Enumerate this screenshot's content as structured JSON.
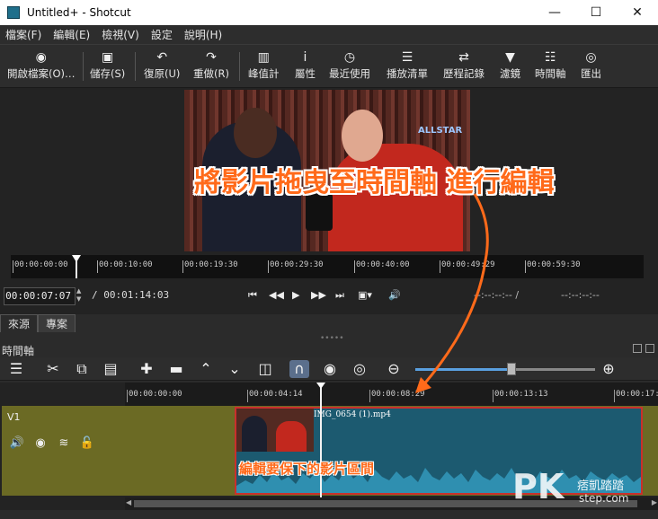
{
  "window": {
    "title": "Untitled+ - Shotcut",
    "minimize": "—",
    "maximize": "☐",
    "close": "✕"
  },
  "menu": [
    "檔案(F)",
    "編輯(E)",
    "檢視(V)",
    "設定",
    "說明(H)"
  ],
  "toolbar": [
    {
      "icon": "eye-icon",
      "glyph": "◉",
      "label": "開啟檔案(O)…"
    },
    {
      "icon": "save-icon",
      "glyph": "▣",
      "label": "儲存(S)"
    },
    {
      "icon": "undo-icon",
      "glyph": "↶",
      "label": "復原(U)"
    },
    {
      "icon": "redo-icon",
      "glyph": "↷",
      "label": "重做(R)"
    },
    {
      "icon": "meter-icon",
      "glyph": "▥",
      "label": "峰值計"
    },
    {
      "icon": "info-icon",
      "glyph": "i",
      "label": "屬性"
    },
    {
      "icon": "clock-icon",
      "glyph": "◷",
      "label": "最近使用"
    },
    {
      "icon": "list-icon",
      "glyph": "☰",
      "label": "播放清單"
    },
    {
      "icon": "history-icon",
      "glyph": "⇄",
      "label": "歷程記錄"
    },
    {
      "icon": "filter-icon",
      "glyph": "▼",
      "label": "濾鏡"
    },
    {
      "icon": "timeline-icon",
      "glyph": "☷",
      "label": "時間軸"
    },
    {
      "icon": "export-icon",
      "glyph": "◎",
      "label": "匯出"
    }
  ],
  "player": {
    "ruler_ticks": [
      "00:00:00:00",
      "00:00:10:00",
      "00:00:19:30",
      "00:00:29:30",
      "00:00:40:00",
      "00:00:49:29",
      "00:00:59:30"
    ],
    "overlay_text": "ALLSTAR",
    "current_time": "00:00:07:07",
    "total_time": "/ 00:01:14:03",
    "in_point": "--:--:--:-- /",
    "out_point": "--:--:--:--"
  },
  "tabs": [
    "來源",
    "專案"
  ],
  "timeline": {
    "panel_title": "時間軸",
    "ruler_ticks": [
      "00:00:00:00",
      "00:00:04:14",
      "00:00:08:29",
      "00:00:13:13",
      "00:00:17:2"
    ],
    "track_name": "V1",
    "clip_name": "IMG_0654 (1).mp4"
  },
  "annotations": {
    "headline": "將影片拖曳至時間軸  進行編輯",
    "clip_note": "編輯要保下的影片區間",
    "arrow_color": "#ff6a1a"
  },
  "watermark": {
    "pk": "PK",
    "name": "痞凱踏踏",
    "url": "step.com"
  }
}
